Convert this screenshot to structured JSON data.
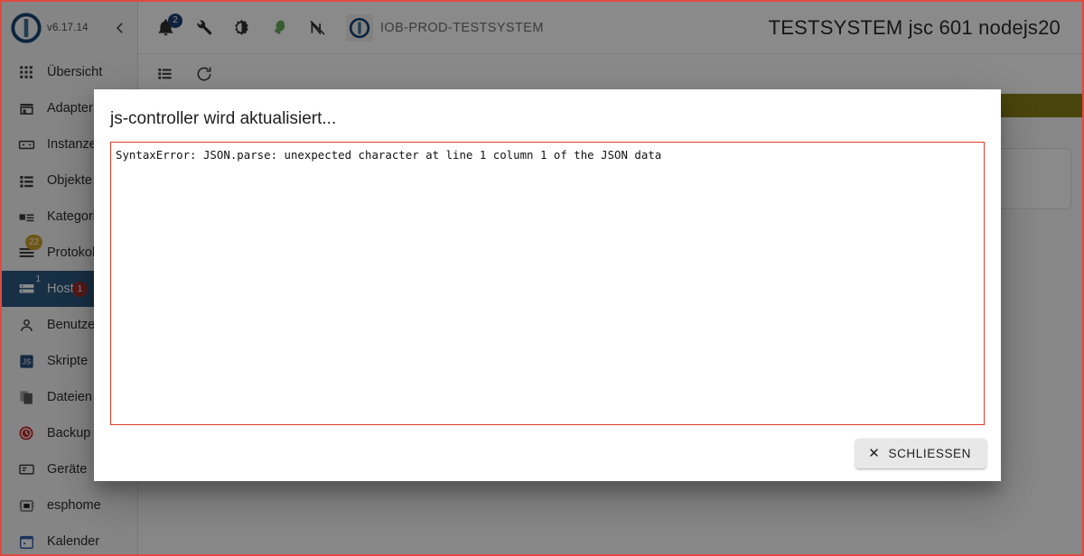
{
  "brand": {
    "logo_icon": "iobroker-logo-icon",
    "version": "v6.17.14",
    "collapse_icon": "chevron-left-icon"
  },
  "sidebar": {
    "items": [
      {
        "label": "Übersicht",
        "icon": "grid-icon"
      },
      {
        "label": "Adapter",
        "icon": "shop-icon"
      },
      {
        "label": "Instanzen",
        "icon": "instances-icon"
      },
      {
        "label": "Objekte",
        "icon": "list-objects-icon"
      },
      {
        "label": "Kategorien",
        "icon": "categories-icon"
      },
      {
        "label": "Protokolle",
        "icon": "logs-icon",
        "badge": "22",
        "badge_color": "#c9a227"
      },
      {
        "label": "Hosts",
        "icon": "hosts-icon",
        "badge": "1",
        "badge_color": "#9e2f2f",
        "superscript": "1",
        "selected": true
      },
      {
        "label": "Benutzer",
        "icon": "user-icon"
      },
      {
        "label": "Skripte",
        "icon": "js-icon"
      },
      {
        "label": "Dateien",
        "icon": "files-icon"
      },
      {
        "label": "Backup",
        "icon": "backup-clock-icon"
      },
      {
        "label": "Geräte",
        "icon": "devices-icon"
      },
      {
        "label": "esphome",
        "icon": "esphome-icon"
      },
      {
        "label": "Kalender",
        "icon": "calendar-icon"
      }
    ]
  },
  "topbar": {
    "icons": [
      {
        "name": "notifications-bell-icon",
        "badge": "2",
        "badge_color": "#1d3f72"
      },
      {
        "name": "wrench-icon"
      },
      {
        "name": "brightness-contrast-icon"
      },
      {
        "name": "expert-mode-icon",
        "color": "#6aab5a"
      },
      {
        "name": "sync-off-icon"
      }
    ],
    "host_logo_icon": "iobroker-logo-icon",
    "host_name": "IOB-PROD-TESTSYSTEM",
    "page_title": "TESTSYSTEM jsc 601 nodejs20"
  },
  "subtoolbar": {
    "icons": [
      {
        "name": "list-view-icon"
      },
      {
        "name": "refresh-icon"
      }
    ]
  },
  "content": {
    "notice_bar_color": "#8a8019",
    "info_icon": "info-circle-icon"
  },
  "dialog": {
    "title": "js-controller wird aktualisiert...",
    "error_text": "SyntaxError: JSON.parse: unexpected character at line 1 column 1 of the JSON data",
    "error_border_color": "#e03b28",
    "close_button": {
      "label": "SCHLIESSEN",
      "icon": "close-x-icon"
    }
  }
}
